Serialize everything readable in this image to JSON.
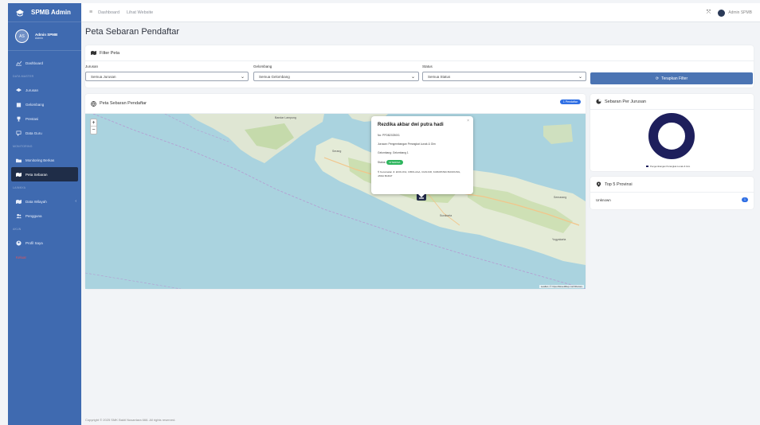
{
  "app": {
    "brand": "SPMB Admin",
    "accent": "#3f6ab0"
  },
  "sidebar": {
    "user_initials": "AS",
    "user_name": "Admin SPMB",
    "user_role": "Admin",
    "sections": {
      "s1": "DATA MASTER",
      "s2": "MONITORING",
      "s3": "LAINNYA",
      "s4": "AKUN"
    },
    "items": {
      "dashboard": "Dashboard",
      "jurusan": "Jurusan",
      "gelombang": "Gelombang",
      "prestasi": "Prestasi",
      "data_guru": "Data Guru",
      "monitoring": "Monitoring Berkas",
      "peta": "Peta Sebaran",
      "wilayah": "Data Wilayah",
      "pengguna": "Pengguna",
      "profil": "Profil Saya",
      "logout": "Keluar"
    }
  },
  "topbar": {
    "dashboard": "Dashboard",
    "website": "Lihat Website",
    "admin": "Admin SPMB"
  },
  "page_title": "Peta Sebaran Pendaftar",
  "filter": {
    "title": "Filter Peta",
    "jurusan_label": "Jurusan",
    "jurusan_value": "Semua Jurusan",
    "gelombang_label": "Gelombang",
    "gelombang_value": "Semua Gelombang",
    "status_label": "Status",
    "status_value": "Semua Status",
    "apply": "Terapkan Filter"
  },
  "map": {
    "title": "Peta Sebaran Pendaftar",
    "badge": "1 Pendaftar",
    "attribution": "Leaflet | © OpenStreetMap contributors",
    "cities": [
      "Bandar Lampung",
      "Serang",
      "Semarang",
      "Surakarta",
      "Yogyakarta"
    ],
    "popup": {
      "name": "Rezdika akbar dwi putra hadi",
      "no": "No: PPDB2025001",
      "jurusan": "Jurusan: Pengembangan Perangkat Lunak & Gim",
      "gelombang": "Gelombang: Gelombang 1",
      "status_label": "Status:",
      "status_value": "DITERIMA",
      "address": "Kecamatan Jl. EKOLOGI, CIBOLAGA, CIANJUR, KABUPATEN BANDUNG, JAWA BARAT"
    }
  },
  "jurusan_chart": {
    "title": "Sebaran Per Jurusan",
    "legend": "Pengembangan Perangkat Lunak & Gim",
    "color": "#1e1f5c"
  },
  "chart_data": {
    "type": "pie",
    "categories": [
      "Pengembangan Perangkat Lunak & Gim"
    ],
    "values": [
      1
    ]
  },
  "provinsi": {
    "title": "Top 5 Provinsi",
    "rows": [
      {
        "name": "Unknown",
        "count": "1"
      }
    ]
  },
  "footer": "Copyright © 2025 SMK Bakti Nusantara 666. All rights reserved."
}
